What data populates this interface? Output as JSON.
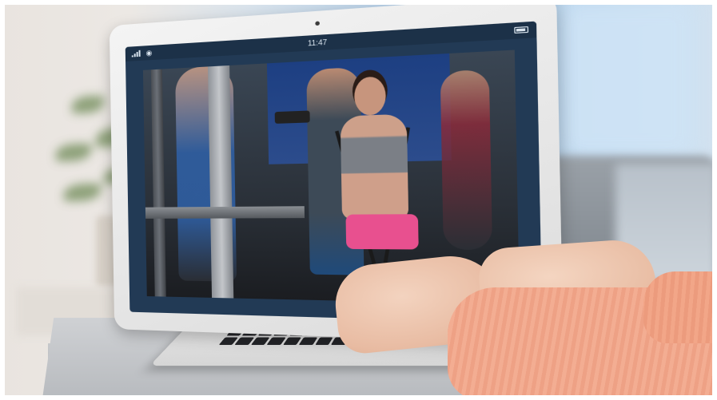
{
  "photo": {
    "status_bar": {
      "time": "11:47",
      "signal_icon": "signal-bars-icon",
      "wifi_icon": "wifi-icon",
      "battery_icon": "battery-icon"
    },
    "colors": {
      "screen_frame": "#223a55",
      "sleeve": "#f3ad92",
      "shorts": "#e8508f"
    }
  }
}
